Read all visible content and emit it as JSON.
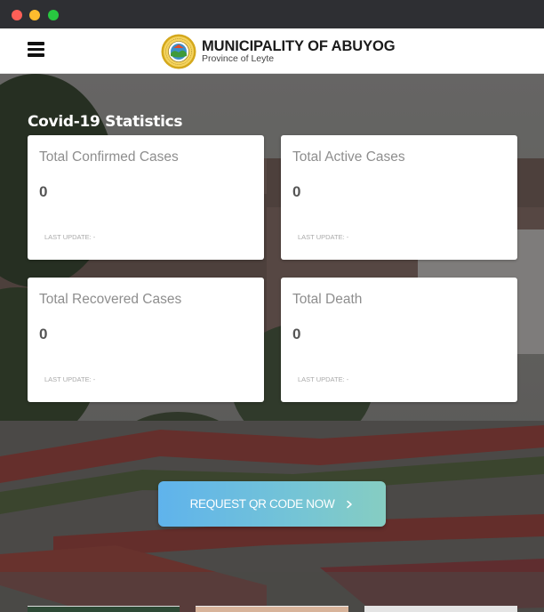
{
  "window": {
    "controls": [
      "close",
      "minimize",
      "maximize"
    ]
  },
  "header": {
    "menu_icon": "hamburger-menu-icon",
    "title": "MUNICIPALITY OF ABUYOG",
    "subtitle": "Province of Leyte",
    "seal_text": "MUNICIPALITY OF ABUYOG · LEYTE"
  },
  "stats": {
    "heading": "Covid-19 Statistics",
    "cards": [
      {
        "label": "Total Confirmed Cases",
        "value": "0",
        "update": "LAST UPDATE: -"
      },
      {
        "label": "Total Active Cases",
        "value": "0",
        "update": "LAST UPDATE: -"
      },
      {
        "label": "Total Recovered Cases",
        "value": "0",
        "update": "LAST UPDATE: -"
      },
      {
        "label": "Total Death",
        "value": "0",
        "update": "LAST UPDATE: -"
      }
    ]
  },
  "cta": {
    "label": "REQUEST QR CODE NOW",
    "icon": "chevron-right-icon"
  },
  "colors": {
    "titlebar": "#2e2f33",
    "cta_start": "#5fb3ec",
    "cta_end": "#86cdc2",
    "card_label": "#8e8e8e",
    "card_value": "#555555"
  }
}
